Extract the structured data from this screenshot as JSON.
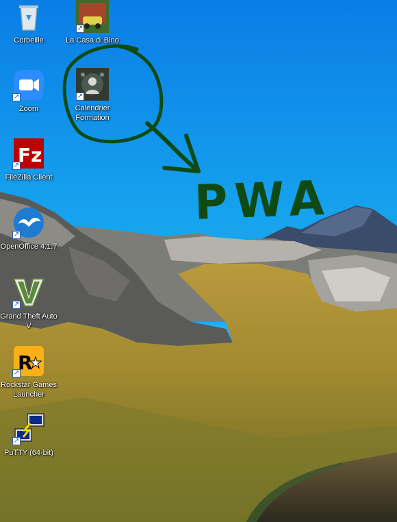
{
  "desktop": {
    "icons": [
      {
        "name": "recycle-bin",
        "label": "Corbeille",
        "icon": "recycle-bin-icon"
      },
      {
        "name": "la-casa-di-bino",
        "label": "La Casa di Bino",
        "icon": "game-cover-icon"
      },
      {
        "name": "zoom",
        "label": "Zoom",
        "icon": "video-camera-icon"
      },
      {
        "name": "calendrier-formation",
        "label": "Calendrier Formation",
        "icon": "calendar-app-icon"
      },
      {
        "name": "filezilla",
        "label": "FileZilla Client",
        "icon": "filezilla-icon"
      },
      {
        "name": "openoffice",
        "label": "OpenOffice 4.1.7",
        "icon": "openoffice-gull-icon"
      },
      {
        "name": "gta-v",
        "label": "Grand Theft Auto V",
        "icon": "gta-v-icon"
      },
      {
        "name": "rockstar-launcher",
        "label": "Rockstar Games Launcher",
        "icon": "rockstar-icon"
      },
      {
        "name": "putty",
        "label": "PuTTY (64-bit)",
        "icon": "putty-terminal-icon"
      }
    ]
  },
  "annotation": {
    "text": "PWA",
    "color": "#0f4a14"
  }
}
